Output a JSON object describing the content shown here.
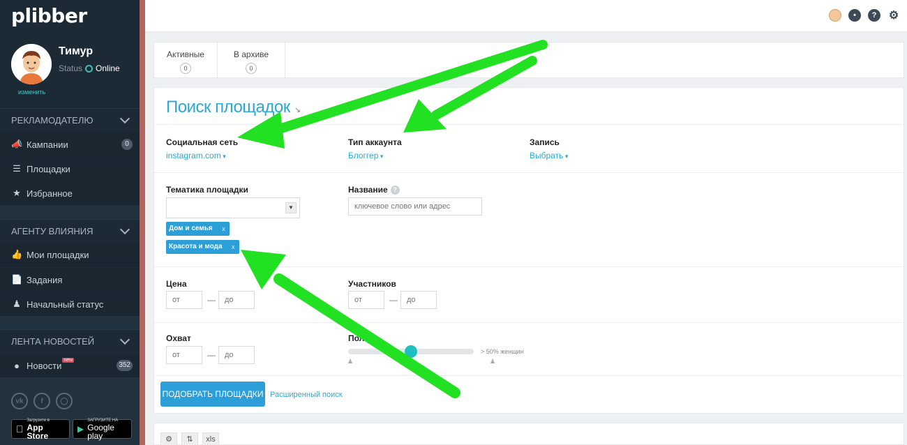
{
  "app": {
    "logo": "plibber"
  },
  "user": {
    "name": "Тимур",
    "status_label": "Status",
    "status_value": "Online",
    "change_link": "изменить"
  },
  "sidebar": {
    "sections": [
      {
        "title": "РЕКЛАМОДАТЕЛЮ",
        "items": [
          {
            "label": "Кампании",
            "icon": "megaphone-icon",
            "badge": "0"
          },
          {
            "label": "Площадки",
            "icon": "list-icon"
          },
          {
            "label": "Избранное",
            "icon": "star-icon"
          }
        ]
      },
      {
        "title": "АГЕНТУ ВЛИЯНИЯ",
        "items": [
          {
            "label": "Мои площадки",
            "icon": "thumbs-up-icon"
          },
          {
            "label": "Задания",
            "icon": "document-icon"
          },
          {
            "label": "Начальный статус",
            "icon": "user-icon"
          }
        ]
      },
      {
        "title": "ЛЕНТА НОВОСТЕЙ",
        "items": [
          {
            "label": "Новости",
            "icon": "feed-icon",
            "new_badge": "new",
            "badge": "352"
          }
        ]
      }
    ],
    "social": [
      "vk-icon",
      "facebook-icon",
      "instagram-icon"
    ],
    "stores": [
      {
        "small": "Загрузите в",
        "big": "App Store"
      },
      {
        "small": "ЗАГРУЗИТЕ НА",
        "big": "Google play"
      }
    ]
  },
  "tabs": [
    {
      "label": "Активные",
      "count": "0"
    },
    {
      "label": "В архиве",
      "count": "0"
    }
  ],
  "search": {
    "title": "Поиск площадок",
    "social_network": {
      "label": "Социальная сеть",
      "value": "instagram.com"
    },
    "account_type": {
      "label": "Тип аккаунта",
      "value": "Блоггер"
    },
    "record": {
      "label": "Запись",
      "value": "Выбрать"
    },
    "topic": {
      "label": "Тематика площадки",
      "tags": [
        "Дом и семья",
        "Красота и мода"
      ],
      "tag_remove": "x"
    },
    "name": {
      "label": "Название",
      "placeholder": "ключевое слово или адрес"
    },
    "price": {
      "label": "Цена",
      "from": "от",
      "to": "до"
    },
    "participants": {
      "label": "Участников",
      "from": "от",
      "to": "до"
    },
    "reach": {
      "label": "Охват",
      "from": "от",
      "to": "до"
    },
    "gender": {
      "label": "Пол",
      "note": "> 50% женщин",
      "slider_fraction": 0.5
    },
    "submit_label": "ПОДОБРАТЬ ПЛОЩАДКИ",
    "advanced_link": "Расширенный поиск"
  },
  "toolbar": {
    "settings": "⚙",
    "sort": "⇅",
    "xls": "xls"
  },
  "colors": {
    "accent": "#2c9fd8",
    "sidebar_bg": "#1c2a36",
    "annotation": "#22e022"
  }
}
